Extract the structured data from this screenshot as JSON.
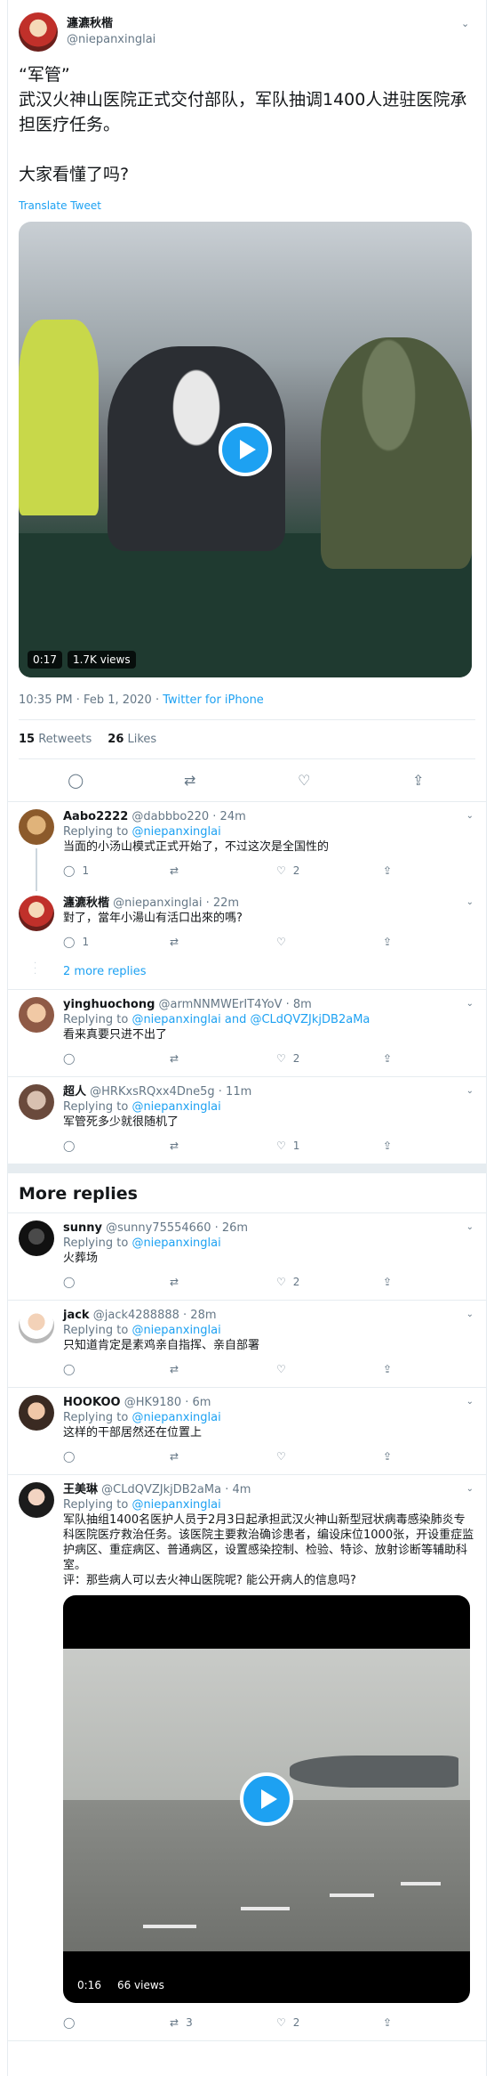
{
  "tweet": {
    "display_name": "瀍瀌秋楷",
    "username": "@niepanxinglai",
    "text": "“军管”\n武汉火神山医院正式交付部队，军队抽调1400人进驻医院承担医疗任务。\n\n大家看懂了吗?",
    "translate_label": "Translate Tweet",
    "video": {
      "duration": "0:17",
      "views": "1.7K views"
    },
    "timestamp": "10:35 PM · Feb 1, 2020 · ",
    "source": "Twitter for iPhone",
    "retweets_count": "15",
    "retweets_label": "Retweets",
    "likes_count": "26",
    "likes_label": "Likes"
  },
  "replies": [
    {
      "display_name": "Aabo2222",
      "username": "@dabbbo220",
      "time": "· 24m",
      "replying_prefix": "Replying to ",
      "replying_to": "@niepanxinglai",
      "text": "当面的小汤山模式正式开始了，不过这次是全国性的",
      "reply_count": "1",
      "retweet_count": "",
      "like_count": "2"
    },
    {
      "display_name": "瀍瀌秋楷",
      "username": "@niepanxinglai",
      "time": "· 22m",
      "text": "對了，當年小湯山有活口出來的嗎?",
      "reply_count": "1",
      "retweet_count": "",
      "like_count": ""
    },
    {
      "display_name": "yinghuochong",
      "username": "@armNNMWErIT4YoV",
      "time": "· 8m",
      "replying_prefix": "Replying to ",
      "replying_to": "@niepanxinglai and @CLdQVZJkjDB2aMa",
      "text": "看来真要只进不出了",
      "reply_count": "",
      "retweet_count": "",
      "like_count": "2"
    },
    {
      "display_name": "超人",
      "username": "@HRKxsRQxx4Dne5g",
      "time": "· 11m",
      "replying_prefix": "Replying to ",
      "replying_to": "@niepanxinglai",
      "text": "军管死多少就很随机了",
      "reply_count": "",
      "retweet_count": "",
      "like_count": "1"
    }
  ],
  "more_replies_link": "2 more replies",
  "more_replies_title": "More replies",
  "more_replies": [
    {
      "display_name": "sunny",
      "username": "@sunny75554660",
      "time": "· 26m",
      "replying_prefix": "Replying to ",
      "replying_to": "@niepanxinglai",
      "text": "火葬场",
      "reply_count": "",
      "retweet_count": "",
      "like_count": "2"
    },
    {
      "display_name": "jack",
      "username": "@jack4288888",
      "time": "· 28m",
      "replying_prefix": "Replying to ",
      "replying_to": "@niepanxinglai",
      "text": "只知道肯定是素鸡亲自指挥、亲自部署",
      "reply_count": "",
      "retweet_count": "",
      "like_count": ""
    },
    {
      "display_name": "HOOKOO",
      "username": "@HK9180",
      "time": "· 6m",
      "replying_prefix": "Replying to ",
      "replying_to": "@niepanxinglai",
      "text": "这样的干部居然还在位置上",
      "reply_count": "",
      "retweet_count": "",
      "like_count": ""
    },
    {
      "display_name": "王美琳",
      "username": "@CLdQVZJkjDB2aMa",
      "time": "· 4m",
      "replying_prefix": "Replying to ",
      "replying_to": "@niepanxinglai",
      "text": "军队抽组1400名医护人员于2月3日起承担武汉火神山新型冠状病毒感染肺炎专科医院医疗救治任务。该医院主要救治确诊患者，编设床位1000张，开设重症监护病区、重症病区、普通病区，设置感染控制、检验、特诊、放射诊断等辅助科室。\n评：那些病人可以去火神山医院呢? 能公开病人的信息吗?",
      "video": {
        "duration": "0:16",
        "views": "66 views"
      },
      "reply_count": "",
      "retweet_count": "3",
      "like_count": "2"
    }
  ],
  "icons": {
    "reply": "reply-icon",
    "retweet": "retweet-icon",
    "like": "heart-icon",
    "share": "share-icon",
    "more": "chevron-down-icon"
  },
  "colors": {
    "accent": "#1da1f2",
    "text": "#14171a",
    "secondary": "#657786",
    "border": "#e6ecf0"
  }
}
